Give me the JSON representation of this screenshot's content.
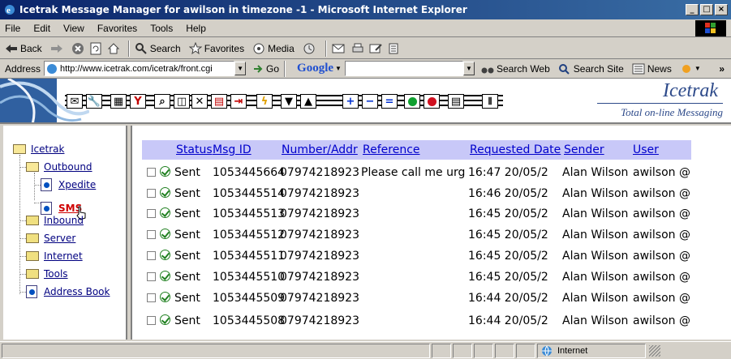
{
  "window": {
    "title": "Icetrak Message Manager for awilson in timezone -1 - Microsoft Internet Explorer"
  },
  "menu": [
    "File",
    "Edit",
    "View",
    "Favorites",
    "Tools",
    "Help"
  ],
  "toolbar": {
    "back": "Back",
    "search": "Search",
    "favorites": "Favorites",
    "media": "Media"
  },
  "address": {
    "label": "Address",
    "url": "http://www.icetrak.com/icetrak/front.cgi",
    "go": "Go",
    "google": "Google",
    "search_web": "Search Web",
    "search_site": "Search Site",
    "news": "News"
  },
  "banner": {
    "logo": "Icetrak",
    "tagline": "Total on-line Messaging"
  },
  "tree": {
    "root": "Icetrak",
    "outbound": "Outbound",
    "xpedite": "Xpedite",
    "sms": "SMS",
    "inbound": "Inbound",
    "server": "Server",
    "internet": "Internet",
    "tools": "Tools",
    "address_book": "Address Book"
  },
  "table": {
    "headers": {
      "status": "Status",
      "msg_id": "Msg ID",
      "number": "Number/Addr",
      "reference": "Reference",
      "requested": "Requested Date",
      "sender": "Sender",
      "user": "User"
    },
    "rows": [
      {
        "status": "Sent",
        "msg_id": "1053445664",
        "number": "07974218923",
        "reference": "Please call me urg",
        "date": "16:47 20/05/2",
        "sender": "Alan Wilson",
        "user": "awilson @"
      },
      {
        "status": "Sent",
        "msg_id": "1053445514",
        "number": "07974218923",
        "reference": "",
        "date": "16:46 20/05/2",
        "sender": "Alan Wilson",
        "user": "awilson @"
      },
      {
        "status": "Sent",
        "msg_id": "1053445513",
        "number": "07974218923",
        "reference": "",
        "date": "16:45 20/05/2",
        "sender": "Alan Wilson",
        "user": "awilson @"
      },
      {
        "status": "Sent",
        "msg_id": "1053445512",
        "number": "07974218923",
        "reference": "",
        "date": "16:45 20/05/2",
        "sender": "Alan Wilson",
        "user": "awilson @"
      },
      {
        "status": "Sent",
        "msg_id": "1053445511",
        "number": "07974218923",
        "reference": "",
        "date": "16:45 20/05/2",
        "sender": "Alan Wilson",
        "user": "awilson @"
      },
      {
        "status": "Sent",
        "msg_id": "1053445510",
        "number": "07974218923",
        "reference": "",
        "date": "16:45 20/05/2",
        "sender": "Alan Wilson",
        "user": "awilson @"
      },
      {
        "status": "Sent",
        "msg_id": "1053445509",
        "number": "07974218923",
        "reference": "",
        "date": "16:44 20/05/2",
        "sender": "Alan Wilson",
        "user": "awilson @"
      },
      {
        "status": "Sent",
        "msg_id": "1053445508",
        "number": "07974218923",
        "reference": "",
        "date": "16:44 20/05/2",
        "sender": "Alan Wilson",
        "user": "awilson @"
      }
    ]
  },
  "status": {
    "zone": "Internet"
  },
  "colors": {
    "title_bar": "#0a246a",
    "header_bg": "#c8c8f8",
    "link": "#0000cc",
    "sent_ok": "#208020",
    "active_link": "#d00000"
  }
}
